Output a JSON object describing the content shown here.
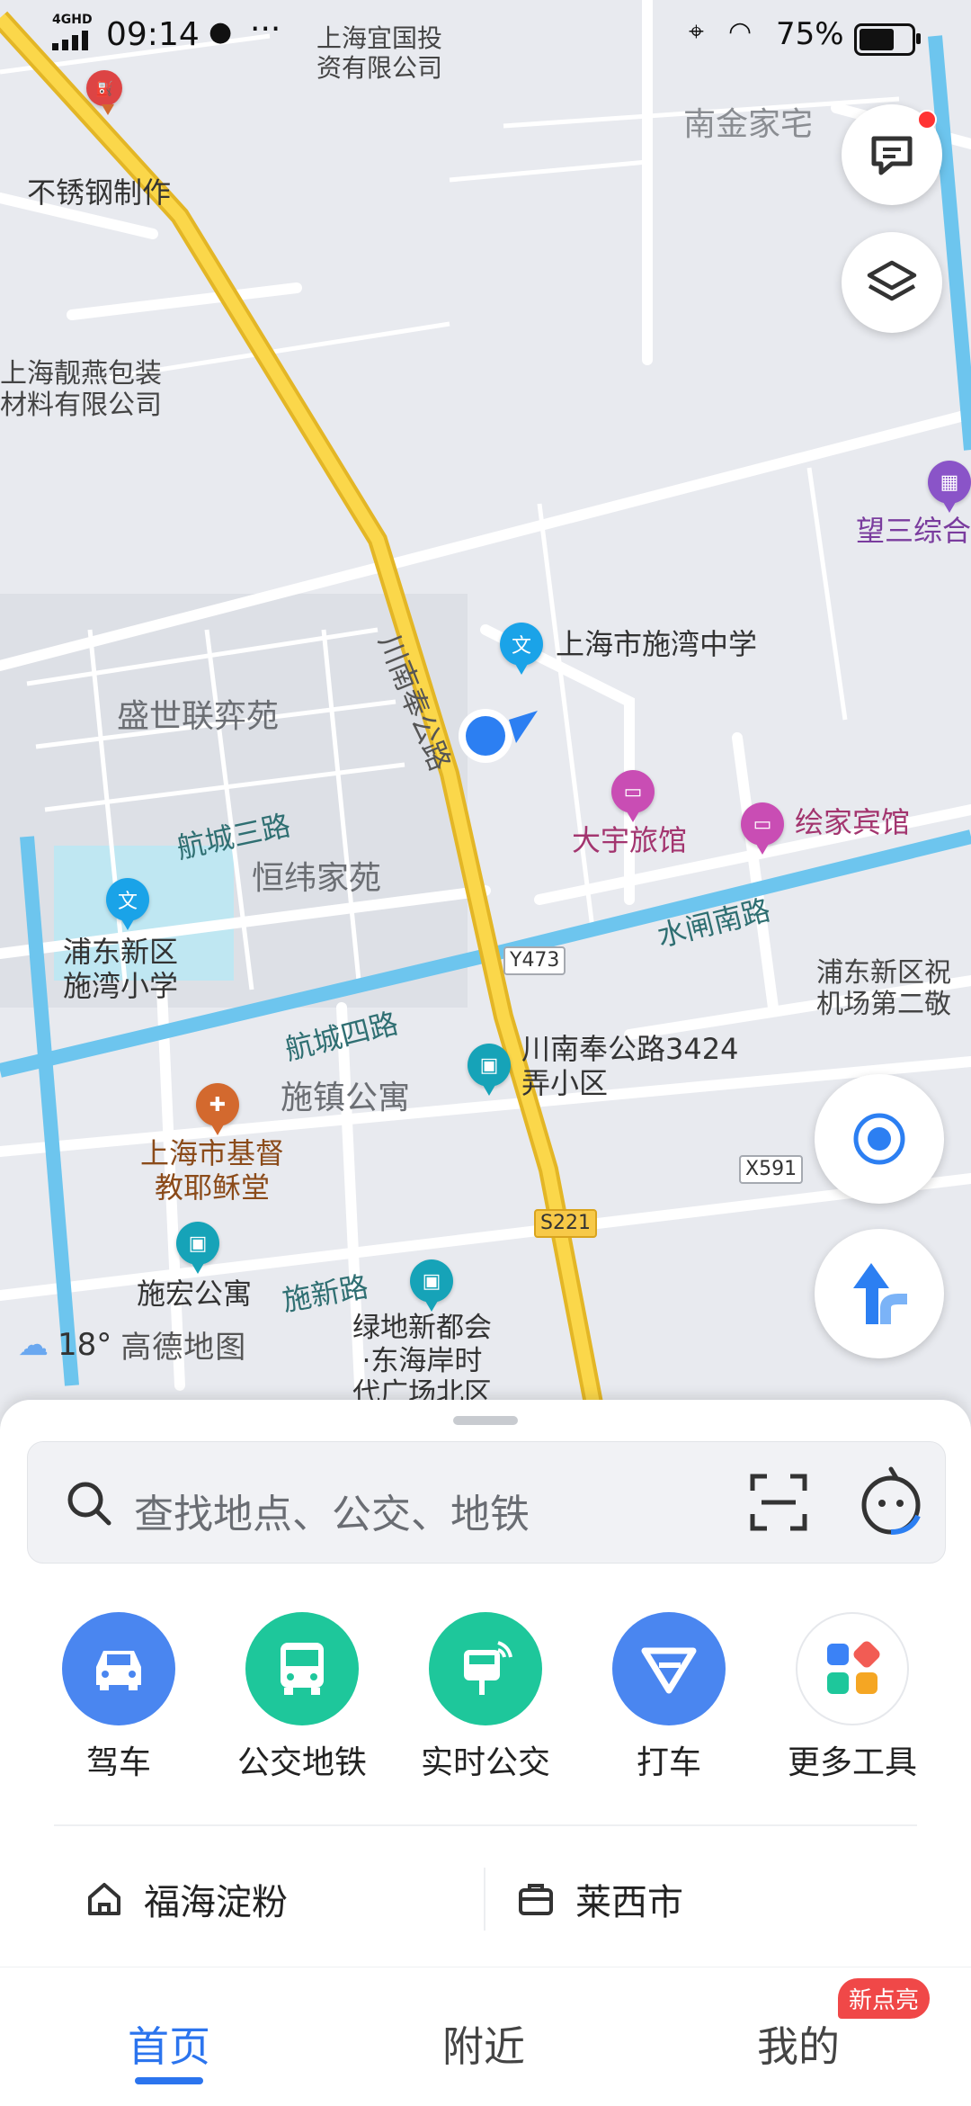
{
  "status_bar": {
    "network": "4GHD",
    "time": "09:14",
    "battery_percent": "75%",
    "battery_level": 0.75,
    "icons": [
      "signal-icon",
      "chat-bubble-icon",
      "more-dots-icon",
      "location-icon",
      "wifi-icon",
      "battery-icon"
    ]
  },
  "map": {
    "labels": {
      "yiguo": "上海宜国投\n资有限公司",
      "nanjin": "南金家宅",
      "steel": "不锈钢制作",
      "liangyan": "上海靓燕包装\n材料有限公司",
      "wangsan": "望三综合",
      "shiwan_school": "上海市施湾中学",
      "shengshi": "盛世联弈苑",
      "chuannan_road": "川南奉公路",
      "hangcheng3": "航城三路",
      "dayu": "大宇旅馆",
      "huijia": "绘家宾馆",
      "hengwei": "恒纬家苑",
      "shuizha": "水闸南路",
      "pudong_school": "浦东新区\n施湾小学",
      "pudong_zhu": "浦东新区祝\n机场第二敬",
      "hangcheng4": "航城四路",
      "shizhen": "施镇公寓",
      "chuannan3424": "川南奉公路3424\n弄小区",
      "church": "上海市基督\n教耶稣堂",
      "shihong": "施宏公寓",
      "shixin": "施新路",
      "lvdi": "绿地新都会\n·东海岸时\n代广场北区"
    },
    "shields": {
      "y473": "Y473",
      "x591": "X591",
      "s221": "S221"
    }
  },
  "weather": {
    "temperature": "18°",
    "brand": "高德地图"
  },
  "search": {
    "placeholder": "查找地点、公交、地铁"
  },
  "tools": [
    {
      "label": "驾车",
      "color": "#4a86f0"
    },
    {
      "label": "公交地铁",
      "color": "#1ec79b"
    },
    {
      "label": "实时公交",
      "color": "#1ec79b"
    },
    {
      "label": "打车",
      "color": "#4a86f0"
    },
    {
      "label": "更多工具",
      "color": "#ffffff"
    }
  ],
  "favorites": {
    "home": "福海淀粉",
    "work": "莱西市"
  },
  "nav": {
    "home": "首页",
    "nearby": "附近",
    "mine": "我的",
    "badge": "新点亮"
  }
}
